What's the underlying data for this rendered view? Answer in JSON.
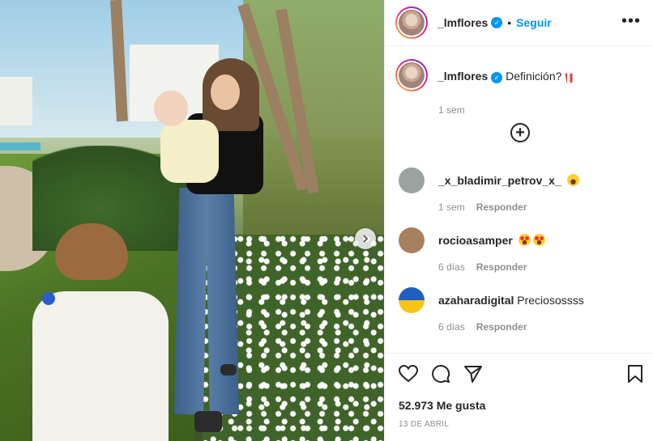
{
  "post": {
    "username": "_lmflores",
    "follow_label": "Seguir",
    "more_label": "•••",
    "dot": "•",
    "caption": "Definición?",
    "caption_time": "1 sem",
    "likes": "52.973 Me gusta",
    "date": "13 DE ABRIL"
  },
  "comments": [
    {
      "username": "_x_bladimir_petrov_x_",
      "text": "",
      "emoji": "laugh",
      "time": "1 sem",
      "reply": "Responder",
      "avatar_color": "#9aa3a0"
    },
    {
      "username": "rocioasamper",
      "text": "",
      "emoji": "hearteyes",
      "time": "6 días",
      "reply": "Responder",
      "avatar_color": "#a6805f"
    },
    {
      "username": "azaharadigital",
      "text": "Preciosossss",
      "emoji": "",
      "time": "6 días",
      "reply": "Responder",
      "avatar_color": "#f5c518"
    }
  ],
  "icons": {
    "like": "heart-icon",
    "comment": "comment-icon",
    "share": "share-icon",
    "save": "bookmark-icon",
    "next": "chevron-right-icon",
    "load_more": "plus-circle-icon",
    "verified": "verified-icon"
  },
  "colors": {
    "accent": "#0095f6",
    "muted": "#8e8e8e",
    "text": "#262626"
  }
}
